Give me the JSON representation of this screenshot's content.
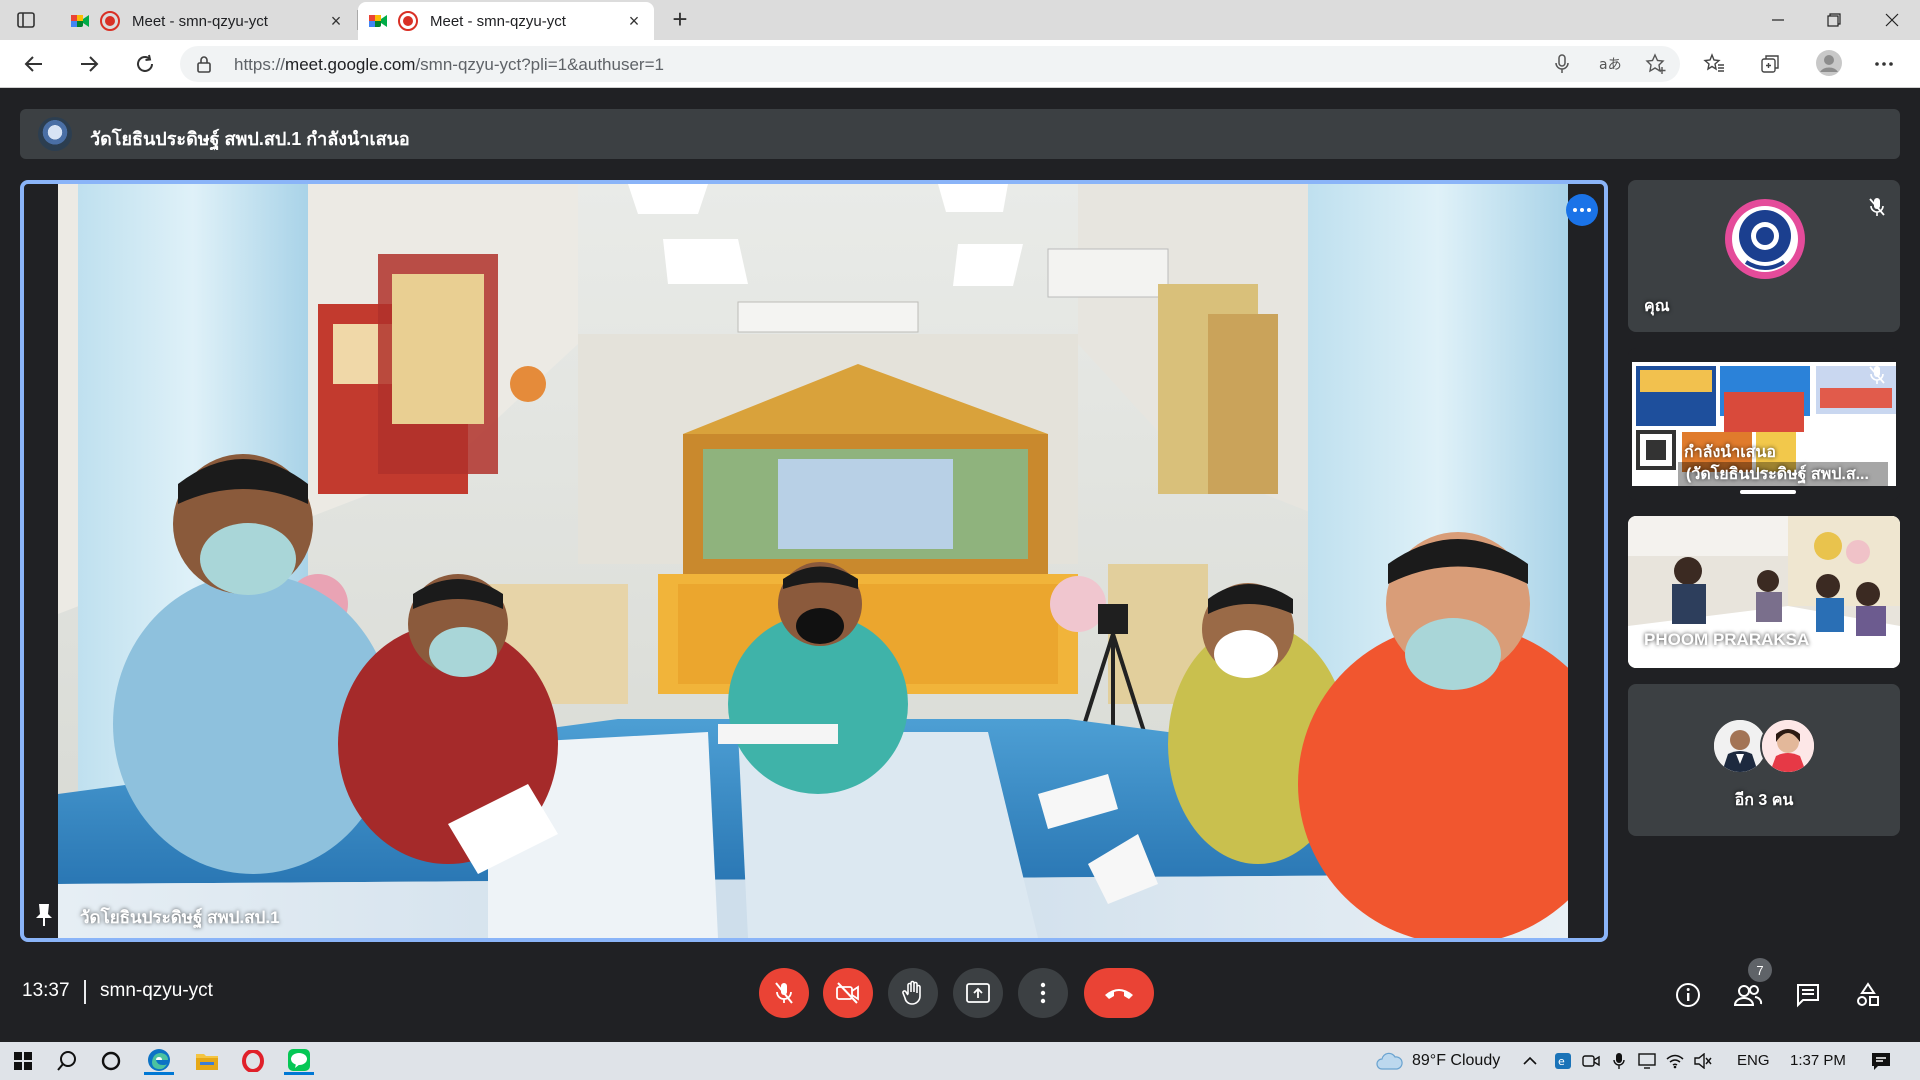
{
  "browser": {
    "tabs": [
      {
        "title": "Meet - smn-qzyu-yct",
        "active": false
      },
      {
        "title": "Meet - smn-qzyu-yct",
        "active": true
      }
    ],
    "new_tab_symbol": "+",
    "close_symbol": "×",
    "url": {
      "scheme": "https://",
      "host": "meet.google.com",
      "path": "/smn-qzyu-yct?pli=1&authuser=1"
    }
  },
  "meet": {
    "presenting_banner": "วัดโยธินประดิษฐ์ สพป.สป.1 กำลังนำเสนอ",
    "main_tile": {
      "name": "วัดโยธินประดิษฐ์ สพป.สป.1"
    },
    "side_tiles": [
      {
        "name": "คุณ",
        "muted": true
      },
      {
        "name": "(วัดโยธินประดิษฐ์ สพป.ส...",
        "overlay_text": "กำลังนำเสนอ",
        "muted": true
      },
      {
        "name": "PHOOM PRARAKSA",
        "muted": false
      },
      {
        "name": "อีก 3 คน"
      }
    ],
    "time": "13:37",
    "meeting_code": "smn-qzyu-yct",
    "participant_count": "7",
    "accent_color": "#8ab4f8",
    "danger_color": "#ea4335"
  },
  "taskbar": {
    "weather": "89°F Cloudy",
    "language": "ENG",
    "clock": "1:37 PM"
  }
}
